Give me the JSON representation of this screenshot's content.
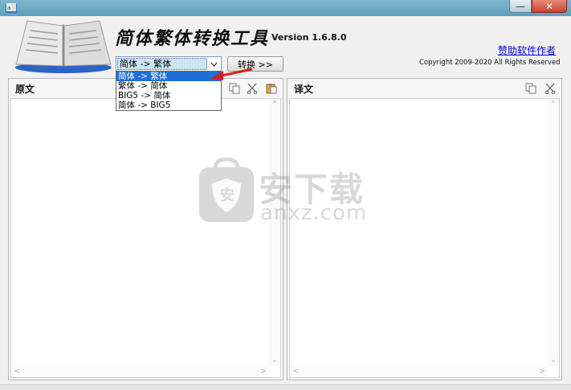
{
  "window": {
    "min_label": "—",
    "close_label": "✕"
  },
  "header": {
    "title": "简体繁体转换工具",
    "version": "Version 1.6.8.0",
    "sponsor_link": "赞助软件作者",
    "copyright": "Copyright 2009-2020 All Rights Reserved"
  },
  "toolbar": {
    "selected_mode": "简体 -> 繁体",
    "convert_label": "转换 >>",
    "modes": [
      "简体 -> 繁体",
      "繁体 -> 简体",
      "BIG5 -> 简体",
      "简体 -> BIG5"
    ]
  },
  "panels": {
    "source_title": "原文",
    "target_title": "译文"
  },
  "watermark": {
    "cn": "安下载",
    "en": "anxz.com"
  },
  "colors": {
    "titlebar": "#6fabc4",
    "selection": "#1e6fd6",
    "link": "#0000ee",
    "pointer": "#d42020"
  },
  "icons": {
    "copy": "copy-icon",
    "cut": "cut-icon",
    "paste": "paste-icon"
  }
}
